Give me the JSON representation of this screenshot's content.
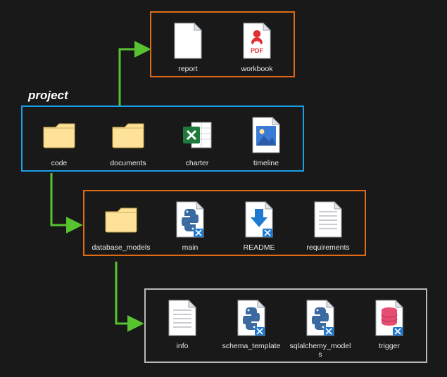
{
  "colors": {
    "accent_orange": "#e06a15",
    "accent_blue": "#1a9ee8",
    "accent_gray": "#b8b8b8",
    "arrow_green": "#56c32f",
    "folder": "#ffe29a",
    "vs_blue": "#1e7ad1",
    "pdf_red": "#e03131",
    "excel_green": "#1e7b3c",
    "db_pink": "#e64d72"
  },
  "rows": {
    "project": {
      "title": "project",
      "items": [
        {
          "label": "code",
          "icon": "folder"
        },
        {
          "label": "documents",
          "icon": "folder"
        },
        {
          "label": "charter",
          "icon": "excel"
        },
        {
          "label": "timeline",
          "icon": "image"
        }
      ]
    },
    "documents": {
      "items": [
        {
          "label": "report",
          "icon": "blank"
        },
        {
          "label": "workbook",
          "icon": "pdf"
        }
      ]
    },
    "code": {
      "items": [
        {
          "label": "database_models",
          "icon": "folder"
        },
        {
          "label": "main",
          "icon": "python"
        },
        {
          "label": "README",
          "icon": "download"
        },
        {
          "label": "requirements",
          "icon": "text"
        }
      ]
    },
    "database_models": {
      "items": [
        {
          "label": "info",
          "icon": "text"
        },
        {
          "label": "schema_template",
          "icon": "python"
        },
        {
          "label": "sqlalchemy_models",
          "icon": "python"
        },
        {
          "label": "trigger",
          "icon": "db"
        }
      ]
    }
  }
}
